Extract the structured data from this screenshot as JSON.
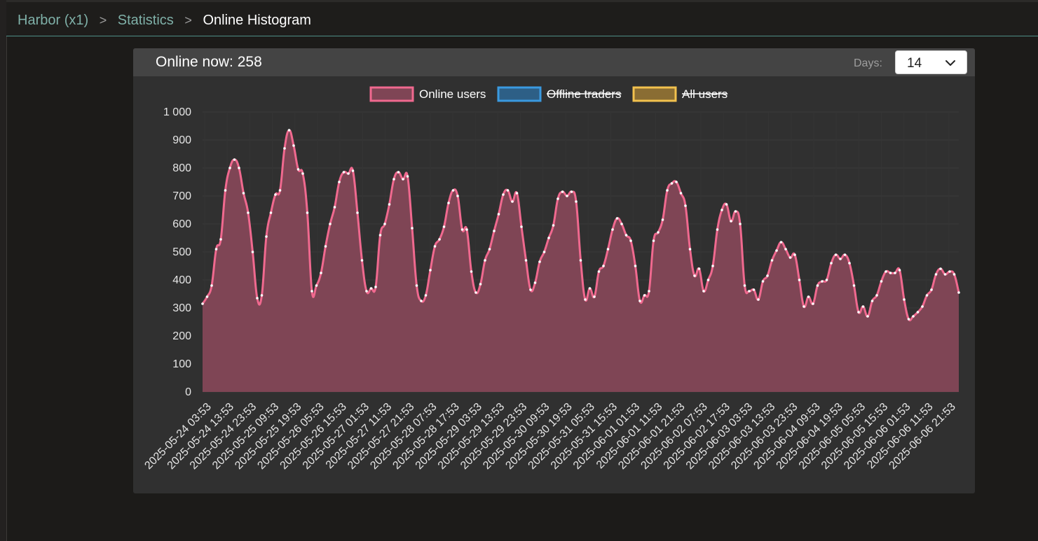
{
  "breadcrumb": {
    "items": [
      "Harbor (x1)",
      "Statistics"
    ],
    "separator": ">",
    "current": "Online Histogram"
  },
  "panel": {
    "online_now": "Online now: 258",
    "days_label": "Days:",
    "days_value": "14"
  },
  "colors": {
    "online": "#f0698f",
    "online_fill": "#7f4555",
    "offline": "#3a9ae0",
    "offline_fill": "#2d5f86",
    "all": "#f2c14e",
    "all_fill": "#8a6d33",
    "accent": "#7fb0a8"
  },
  "icons": {
    "dropdown": "chevron-down-icon"
  },
  "chart_data": {
    "type": "area",
    "title": "",
    "xlabel": "",
    "ylabel": "",
    "ylim": [
      0,
      1000
    ],
    "yticks": [
      "0",
      "100",
      "200",
      "300",
      "400",
      "500",
      "600",
      "700",
      "800",
      "900",
      "1 000"
    ],
    "legend_position": "top-center",
    "grid": true,
    "x_tick_labels": [
      "2025-05-24 03:53",
      "2025-05-24 13:53",
      "2025-05-24 23:53",
      "2025-05-25 09:53",
      "2025-05-25 19:53",
      "2025-05-26 05:53",
      "2025-05-26 15:53",
      "2025-05-27 01:53",
      "2025-05-27 11:53",
      "2025-05-27 21:53",
      "2025-05-28 07:53",
      "2025-05-28 17:53",
      "2025-05-29 03:53",
      "2025-05-29 13:53",
      "2025-05-29 23:53",
      "2025-05-30 09:53",
      "2025-05-30 19:53",
      "2025-05-31 05:53",
      "2025-05-31 15:53",
      "2025-06-01 01:53",
      "2025-06-01 11:53",
      "2025-06-01 21:53",
      "2025-06-02 07:53",
      "2025-06-02 17:53",
      "2025-06-03 03:53",
      "2025-06-03 13:53",
      "2025-06-03 23:53",
      "2025-06-04 09:53",
      "2025-06-04 19:53",
      "2025-06-05 05:53",
      "2025-06-05 15:53",
      "2025-06-06 01:53",
      "2025-06-06 11:53",
      "2025-06-06 21:53"
    ],
    "series": [
      {
        "name": "Online users",
        "hidden": false,
        "values": [
          315,
          340,
          380,
          510,
          545,
          720,
          800,
          830,
          800,
          710,
          640,
          500,
          335,
          345,
          555,
          640,
          705,
          720,
          870,
          935,
          880,
          795,
          780,
          640,
          360,
          380,
          425,
          520,
          600,
          660,
          750,
          785,
          780,
          790,
          640,
          470,
          360,
          370,
          375,
          560,
          600,
          670,
          760,
          785,
          760,
          770,
          585,
          380,
          325,
          345,
          435,
          520,
          545,
          590,
          675,
          720,
          700,
          580,
          580,
          430,
          355,
          385,
          470,
          510,
          575,
          635,
          705,
          720,
          680,
          710,
          590,
          470,
          365,
          390,
          465,
          500,
          550,
          595,
          690,
          715,
          700,
          715,
          680,
          470,
          330,
          370,
          340,
          430,
          450,
          510,
          580,
          620,
          600,
          560,
          540,
          450,
          325,
          345,
          360,
          540,
          570,
          615,
          720,
          745,
          750,
          710,
          665,
          510,
          415,
          440,
          360,
          400,
          450,
          580,
          650,
          670,
          610,
          645,
          600,
          380,
          360,
          365,
          330,
          395,
          415,
          470,
          505,
          535,
          510,
          480,
          490,
          400,
          305,
          340,
          315,
          380,
          395,
          400,
          460,
          490,
          475,
          490,
          460,
          380,
          285,
          305,
          270,
          325,
          345,
          395,
          430,
          425,
          425,
          435,
          330,
          260,
          270,
          285,
          305,
          345,
          365,
          420,
          440,
          420,
          430,
          420,
          355
        ]
      },
      {
        "name": "Offline traders",
        "hidden": true,
        "values": []
      },
      {
        "name": "All users",
        "hidden": true,
        "values": []
      }
    ]
  }
}
